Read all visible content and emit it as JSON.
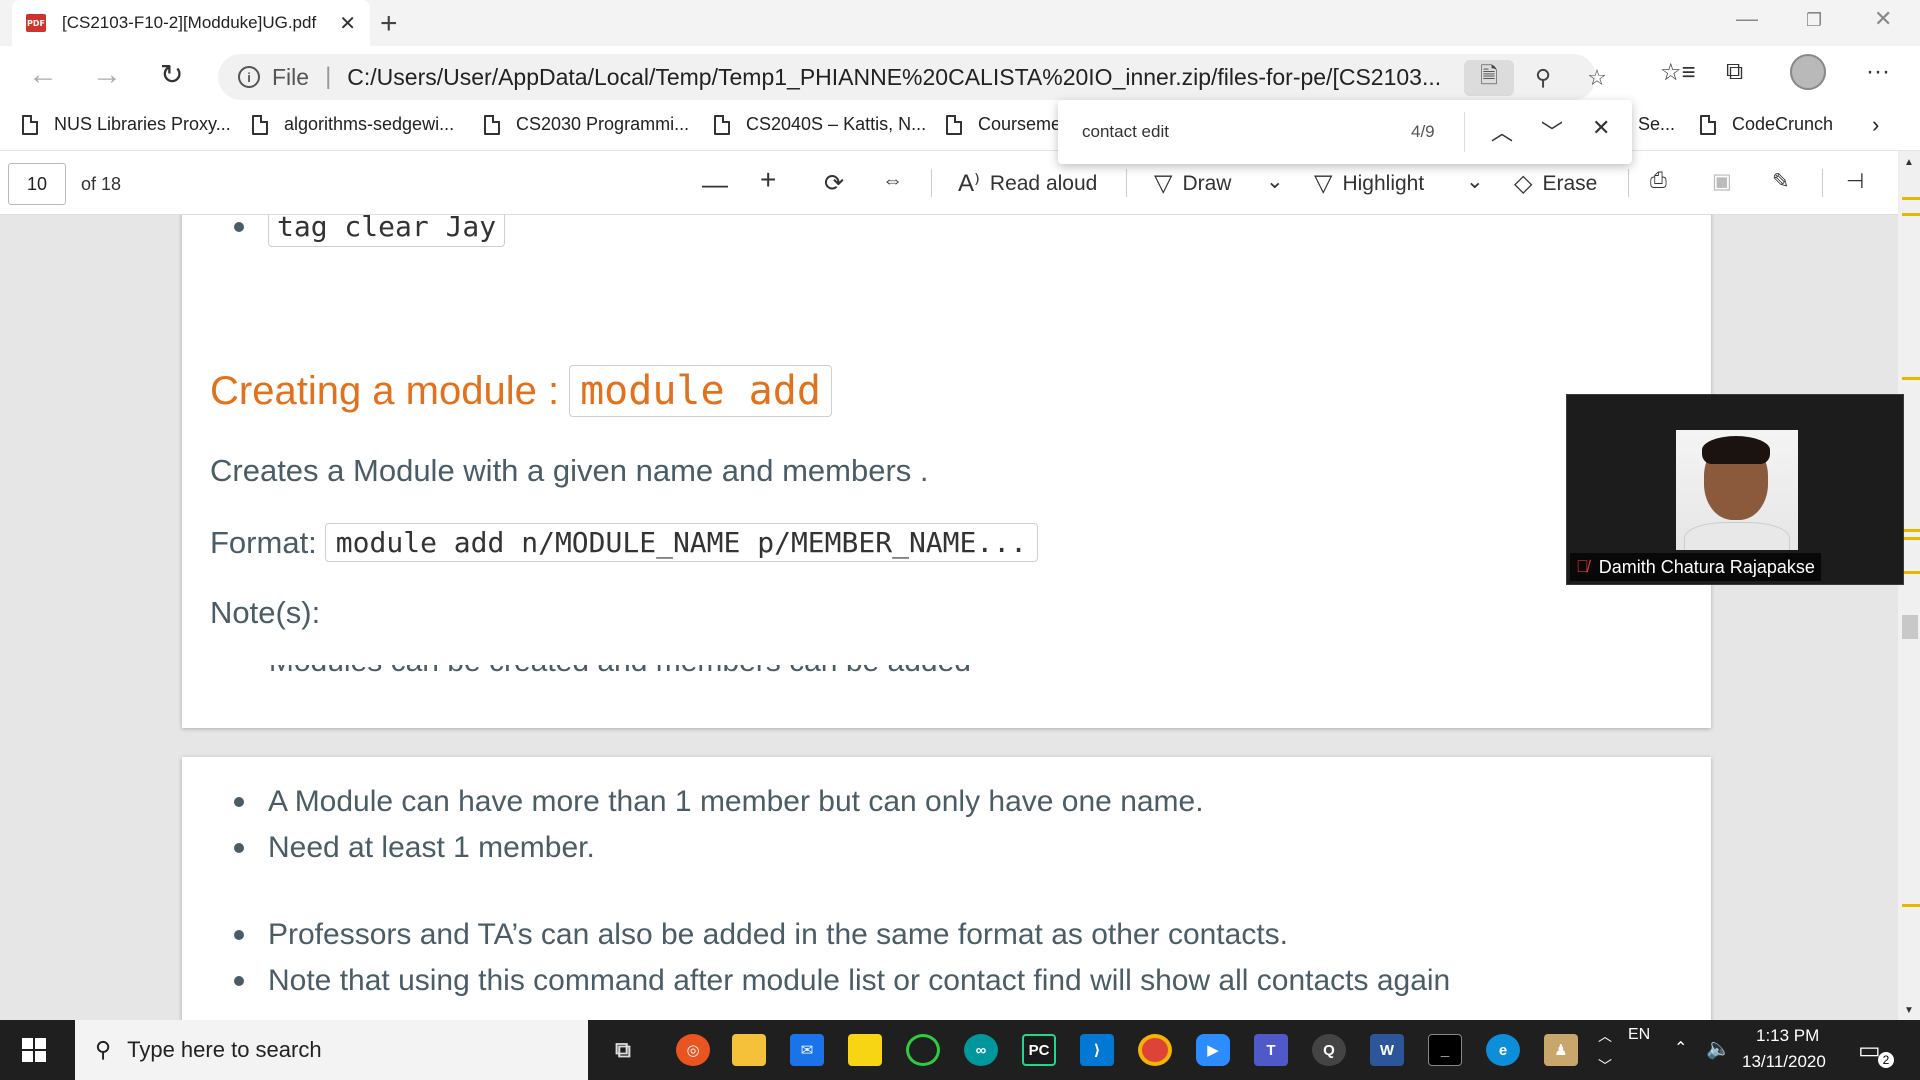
{
  "tab": {
    "title": "[CS2103-F10-2][Modduke]UG.pdf",
    "pdf_badge": "PDF"
  },
  "address": {
    "scheme_label": "File",
    "url": "C:/Users/User/AppData/Local/Temp/Temp1_PHIANNE%20CALISTA%20IO_inner.zip/files-for-pe/[CS2103..."
  },
  "favorites": [
    {
      "label": "NUS Libraries Proxy..."
    },
    {
      "label": "algorithms-sedgewi..."
    },
    {
      "label": "CS2030 Programmi..."
    },
    {
      "label": "CS2040S – Kattis, N..."
    },
    {
      "label": "Courseme"
    },
    {
      "label": "Se..."
    },
    {
      "label": "CodeCrunch"
    }
  ],
  "pdf_toolbar": {
    "page_number": "10",
    "page_total": "of 18",
    "read_aloud": "Read aloud",
    "draw": "Draw",
    "highlight": "Highlight",
    "erase": "Erase"
  },
  "find": {
    "query": "contact edit",
    "count": "4/9"
  },
  "document": {
    "prev_code": "tag clear Jay",
    "heading_text": "Creating a module :",
    "heading_code": "module add",
    "description": "Creates a Module with a given name and members .",
    "format_label": "Format:",
    "format_code": "module add n/MODULE_NAME p/MEMBER_NAME...",
    "notes_label": "Note(s):",
    "cut_line": "• Modules can be created and members can be added",
    "bullets_a": [
      "A Module can have more than 1 member but can only have one name.",
      "Need at least 1 member."
    ],
    "bullets_b": [
      "Professors and TA’s can also be added in the same format as other contacts.",
      "Note that using this command after module list or contact find will show all contacts again"
    ]
  },
  "video": {
    "participant_name": "Damith Chatura Rajapakse"
  },
  "taskbar": {
    "search_placeholder": "Type here to search",
    "lang": "EN",
    "time": "1:13 PM",
    "date": "13/11/2020",
    "notifications": "2"
  }
}
